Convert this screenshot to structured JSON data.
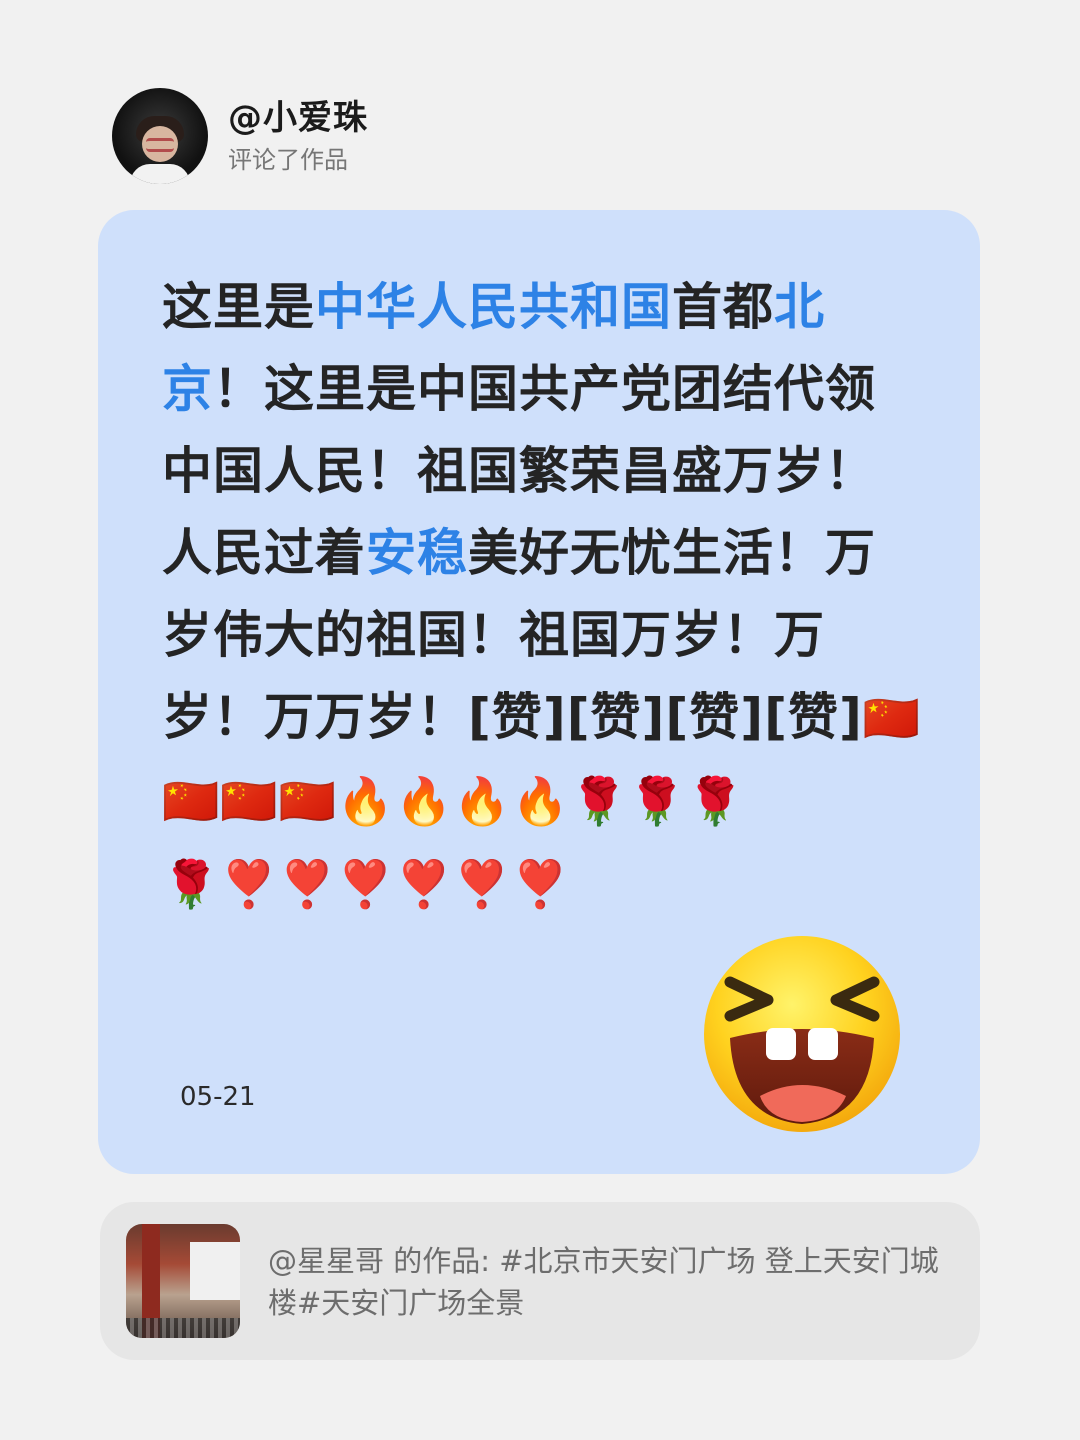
{
  "header": {
    "username": "@小爱珠",
    "subline": "评论了作品"
  },
  "comment": {
    "parts": {
      "p1": "这里是",
      "p2": "中华人民共和国",
      "p3": "首都",
      "p4": "北京",
      "p5": "！这里是中国共产党团结代领中国人民！祖国繁荣昌盛万岁！人民过着",
      "p6": "安稳",
      "p7": "美好无忧生活！万岁伟大的祖国！祖国万岁！万岁！万万岁！[赞][赞][赞][赞]"
    },
    "emojis": {
      "flags": "🇨🇳🇨🇳🇨🇳🇨🇳",
      "fires": "🔥🔥🔥🔥",
      "roses": "🌹🌹🌹🌹",
      "hearts": "❣️❣️❣️❣️❣️❣️"
    },
    "date": "05-21",
    "big_emoji": "laughing-face-icon",
    "highlight_color": "#2d82e6",
    "card_color": "#cfe0fb"
  },
  "reference": {
    "text": "@星星哥 的作品: #北京市天安门广场 登上天安门城楼#天安门广场全景",
    "thumbnail": "tiananmen-thumbnail"
  }
}
